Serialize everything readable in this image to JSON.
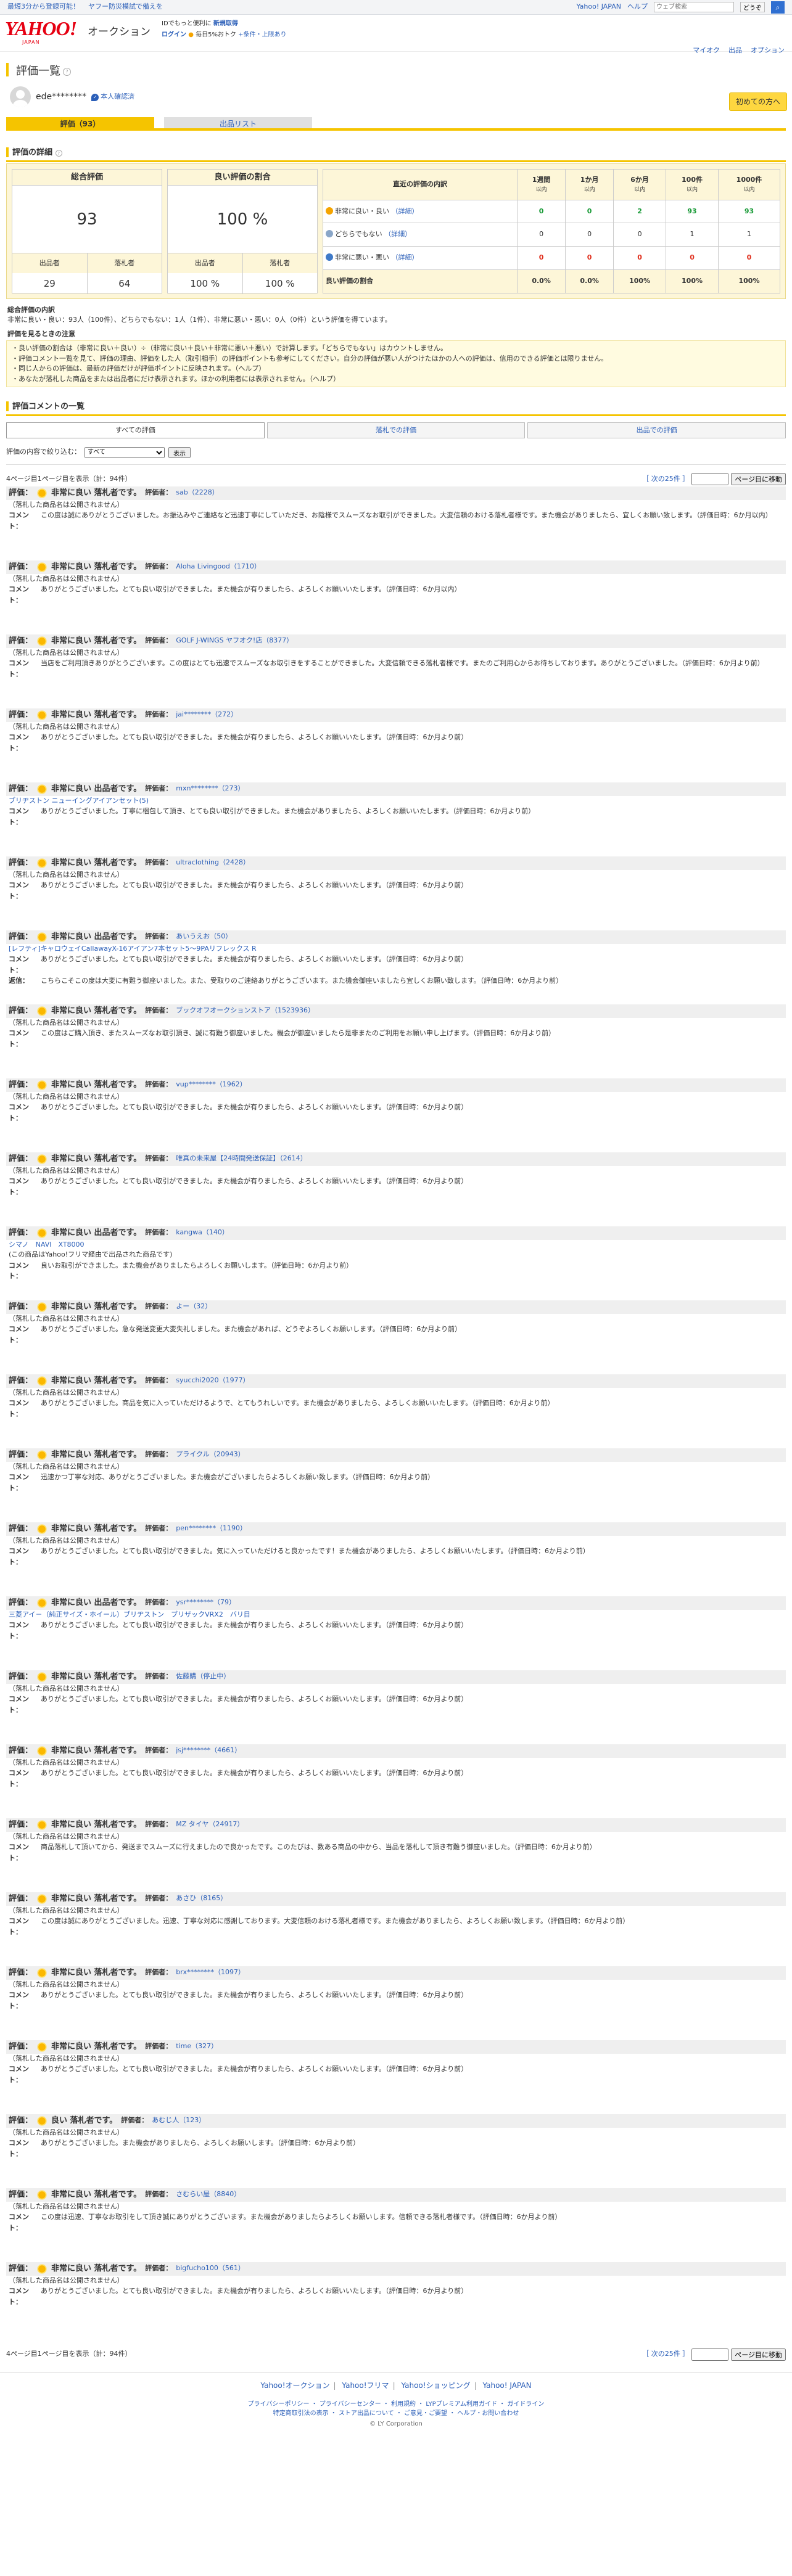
{
  "topbar": {
    "left_links": [
      "最短3分から登録可能！",
      "ヤフー防災模試で備えを"
    ],
    "right_links": [
      "Yahoo! JAPAN",
      "ヘルプ"
    ],
    "search_placeholder": "ウェブ検索",
    "search_button": "どうぞ"
  },
  "header": {
    "logo": "YAHOO!",
    "logo_sub": "JAPAN",
    "service": "オークション",
    "promo_line": "IDでもっと便利に",
    "promo_link": "新規取得",
    "login": "ログイン",
    "deal": "毎日5%おトク",
    "conditions": "+条件・上限あり",
    "links": [
      "マイオク",
      "出品",
      "オプション"
    ]
  },
  "page": {
    "title": "評価一覧",
    "guide_button": "初めての方へ",
    "user_name": "ede********",
    "verified": "本人確認済",
    "tabs": [
      "評価（93）",
      "出品リスト"
    ]
  },
  "details": {
    "section_title": "評価の詳細",
    "total_label": "総合評価",
    "total_value": "93",
    "total_sub_labels": [
      "出品者",
      "落札者"
    ],
    "total_sub_values": [
      "29",
      "64"
    ],
    "good_label": "良い評価の割合",
    "good_value": "100 %",
    "good_sub_labels": [
      "出品者",
      "落札者"
    ],
    "good_sub_values": [
      "100 %",
      "100 %"
    ],
    "recent_header": "直近の評価の内訳",
    "periods": [
      {
        "label": "1週間",
        "sub": "以内"
      },
      {
        "label": "1か月",
        "sub": "以内"
      },
      {
        "label": "6か月",
        "sub": "以内"
      },
      {
        "label": "100件",
        "sub": "以内"
      },
      {
        "label": "1000件",
        "sub": "以内"
      }
    ],
    "rows": [
      {
        "label": "非常に良い・良い",
        "detail": "（詳細）",
        "values": [
          "0",
          "0",
          "2",
          "93",
          "93"
        ]
      },
      {
        "label": "どちらでもない",
        "detail": "（詳細）",
        "values": [
          "0",
          "0",
          "0",
          "1",
          "1"
        ]
      },
      {
        "label": "非常に悪い・悪い",
        "detail": "（詳細）",
        "values": [
          "0",
          "0",
          "0",
          "0",
          "0"
        ]
      }
    ],
    "good_ratio_label": "良い評価の割合",
    "good_ratio_values": [
      "0.0%",
      "0.0%",
      "100%",
      "100%",
      "100%"
    ]
  },
  "notes": {
    "breakdown_title": "総合評価の内訳",
    "breakdown_text": "非常に良い・良い：93人（100件）、どちらでもない：1人（1件）、非常に悪い・悪い：0人（0件）という評価を得ています。",
    "caution_title": "評価を見るときの注意",
    "cautions": [
      "・良い評価の割合は（非常に良い＋良い）÷（非常に良い＋良い＋非常に悪い＋悪い）で計算します。「どちらでもない」はカウントしません。",
      "・評価コメント一覧を見て、評価の理由、評価をした人（取引相手）の評価ポイントも参考にしてください。自分の評価が悪い人がつけたほかの人への評価は、信用のできる評価とは限りません。",
      "・同じ人からの評価は、最新の評価だけが評価ポイントに反映されます。（ヘルプ）",
      "・あなたが落札した商品をまたは出品者にだけ表示されます。ほかの利用者には表示されません。（ヘルプ）"
    ]
  },
  "list": {
    "section_title": "評価コメントの一覧",
    "buttons": [
      "すべての評価",
      "落札での評価",
      "出品での評価"
    ],
    "filter_label": "評価の内容で絞り込む：",
    "filter_value": "すべて",
    "filter_button": "表示",
    "pager_text": "4ページ目1ページ目を表示（計：94件）",
    "next": "［ 次の25件 ］",
    "jump_button": "ページ目に移動"
  },
  "labels": {
    "rating": "評価：",
    "rater": "評価者：",
    "comment": "コメント：",
    "reply": "返信："
  },
  "reviews": [
    {
      "grade": "非常に良い 落札者です。",
      "rater": "sab（2228）",
      "item": "（落札した商品名は公開されません）",
      "comment": "この度は誠にありがとうございました。お振込みやご連絡など迅速丁寧にしていただき、お陰様でスムーズなお取引ができました。大変信頼のおける落札者様です。また機会がありましたら、宜しくお願い致します。（評価日時：6か月以内）"
    },
    {
      "grade": "非常に良い 落札者です。",
      "rater": "Aloha Livingood（1710）",
      "item": "（落札した商品名は公開されません）",
      "comment": "ありがとうございました。とても良い取引ができました。また機会が有りましたら、よろしくお願いいたします。（評価日時：6か月以内）"
    },
    {
      "grade": "非常に良い 落札者です。",
      "rater": "GOLF J-WINGS ヤフオク!店（8377）",
      "item": "（落札した商品名は公開されません）",
      "comment": "当店をご利用頂きありがとうございます。この度はとても迅速でスムーズなお取引きをすることができました。大変信頼できる落札者様です。またのご利用心からお待ちしております。ありがとうございました。（評価日時：6か月より前）"
    },
    {
      "grade": "非常に良い 落札者です。",
      "rater": "jai********（272）",
      "item": "（落札した商品名は公開されません）",
      "comment": "ありがとうございました。とても良い取引ができました。また機会が有りましたら、よろしくお願いいたします。（評価日時：6か月より前）"
    },
    {
      "grade": "非常に良い 出品者です。",
      "rater": "mxn********（273）",
      "item": "ブリヂストン ニューイングアイアンセット(5)",
      "comment": "ありがとうございました。丁寧に梱包して頂き、とても良い取引ができました。また機会がありましたら、よろしくお願いいたします。（評価日時：6か月より前）"
    },
    {
      "grade": "非常に良い 落札者です。",
      "rater": "ultraclothing（2428）",
      "item": "（落札した商品名は公開されません）",
      "comment": "ありがとうございました。とても良い取引ができました。また機会が有りましたら、よろしくお願いいたします。（評価日時：6か月より前）"
    },
    {
      "grade": "非常に良い 出品者です。",
      "rater": "あいうえお（50）",
      "item": "[レフティ]キャロウェイCallawayX-16アイアン7本セット5〜9PAリフレックス R",
      "comment": "ありがとうございました。とても良い取引ができました。また機会が有りましたら、よろしくお願いいたします。（評価日時：6か月より前）",
      "reply": "こちらこそこの度は大変に有難う御座いました。また、受取りのご連絡ありがとうございます。また機会御座いましたら宜しくお願い致します。（評価日時：6か月より前）"
    },
    {
      "grade": "非常に良い 落札者です。",
      "rater": "ブックオフオークションストア（1523936）",
      "item": "（落札した商品名は公開されません）",
      "comment": "この度はご購入頂き、またスムーズなお取引頂き、誠に有難う御座いました。機会が御座いましたら是非またのご利用をお願い申し上げます。（評価日時：6か月より前）"
    },
    {
      "grade": "非常に良い 落札者です。",
      "rater": "vup********（1962）",
      "item": "（落札した商品名は公開されません）",
      "comment": "ありがとうございました。とても良い取引ができました。また機会が有りましたら、よろしくお願いいたします。（評価日時：6か月より前）"
    },
    {
      "grade": "非常に良い 落札者です。",
      "rater": "唯真の未来屋【24時間発送保証】（2614）",
      "item": "（落札した商品名は公開されません）",
      "comment": "ありがとうございました。とても良い取引ができました。また機会が有りましたら、よろしくお願いいたします。（評価日時：6か月より前）"
    },
    {
      "grade": "非常に良い 出品者です。",
      "rater": "kangwa（140）",
      "item": "シマノ　NAVI　XT8000",
      "item2": "(この商品はYahoo!フリマ経由で出品された商品です)",
      "comment": "良いお取引ができました。また機会がありましたらよろしくお願いします。（評価日時：6か月より前）"
    },
    {
      "grade": "非常に良い 落札者です。",
      "rater": "よー（32）",
      "item": "（落札した商品名は公開されません）",
      "comment": "ありがとうございました。急な発送変更大変失礼しました。また機会があれば、どうぞよろしくお願いします。（評価日時：6か月より前）"
    },
    {
      "grade": "非常に良い 落札者です。",
      "rater": "syucchi2020（1977）",
      "item": "（落札した商品名は公開されません）",
      "comment": "ありがとうございました。商品を気に入っていただけるようで、とてもうれしいです。また機会がありましたら、よろしくお願いいたします。（評価日時：6か月より前）"
    },
    {
      "grade": "非常に良い 落札者です。",
      "rater": "プライクル（20943）",
      "item": "（落札した商品名は公開されません）",
      "comment": "迅速かつ丁寧な対応、ありがとうございました。また機会がございましたらよろしくお願い致します。（評価日時：6か月より前）"
    },
    {
      "grade": "非常に良い 落札者です。",
      "rater": "pen********（1190）",
      "item": "（落札した商品名は公開されません）",
      "comment": "ありがとうございました。とても良い取引ができました。気に入っていただけると良かったです！また機会がありましたら、よろしくお願いいたします。（評価日時：6か月より前）"
    },
    {
      "grade": "非常に良い 出品者です。",
      "rater": "ysr********（79）",
      "item": "三菱アイ－（純正サイズ・ホイール）ブリヂストン　ブリザックVRX2　バリ目",
      "comment": "ありがとうございました。とても良い取引ができました。また機会が有りましたら、よろしくお願いいたします。（評価日時：6か月より前）"
    },
    {
      "grade": "非常に良い 落札者です。",
      "rater": "佐藤購（停止中）",
      "item": "（落札した商品名は公開されません）",
      "comment": "ありがとうございました。とても良い取引ができました。また機会が有りましたら、よろしくお願いいたします。（評価日時：6か月より前）"
    },
    {
      "grade": "非常に良い 落札者です。",
      "rater": "jsj********（4661）",
      "item": "（落札した商品名は公開されません）",
      "comment": "ありがとうございました。とても良い取引ができました。また機会が有りましたら、よろしくお願いいたします。（評価日時：6か月より前）"
    },
    {
      "grade": "非常に良い 落札者です。",
      "rater": "MZ タイヤ（24917）",
      "item": "（落札した商品名は公開されません）",
      "comment": "商品落札して頂いてから、発送までスムーズに行えましたので良かったです。このたびは、数ある商品の中から、当品を落札して頂き有難う御座いました。（評価日時：6か月より前）"
    },
    {
      "grade": "非常に良い 落札者です。",
      "rater": "あさひ（8165）",
      "item": "（落札した商品名は公開されません）",
      "comment": "この度は誠にありがとうございました。迅速、丁寧な対応に感謝しております。大変信頼のおける落札者様です。また機会がありましたら、よろしくお願い致します。（評価日時：6か月より前）"
    },
    {
      "grade": "非常に良い 落札者です。",
      "rater": "brx********（1097）",
      "item": "（落札した商品名は公開されません）",
      "comment": "ありがとうございました。とても良い取引ができました。また機会が有りましたら、よろしくお願いいたします。（評価日時：6か月より前）"
    },
    {
      "grade": "非常に良い 落札者です。",
      "rater": "time（327）",
      "item": "（落札した商品名は公開されません）",
      "comment": "ありがとうございました。とても良い取引ができました。また機会が有りましたら、よろしくお願いいたします。（評価日時：6か月より前）"
    },
    {
      "grade": "良い 落札者です。",
      "rater": "あむじ人（123）",
      "item": "（落札した商品名は公開されません）",
      "comment": "ありがとうございました。また機会がありましたら、よろしくお願いします。（評価日時：6か月より前）"
    },
    {
      "grade": "非常に良い 落札者です。",
      "rater": "さむらい屋（8840）",
      "item": "（落札した商品名は公開されません）",
      "comment": "この度は迅速、丁寧なお取引をして頂き誠にありがとうございます。また機会がありましたらよろしくお願いします。信頼できる落札者様です。（評価日時：6か月より前）"
    },
    {
      "grade": "非常に良い 落札者です。",
      "rater": "bigfucho100（561）",
      "item": "（落札した商品名は公開されません）",
      "comment": "ありがとうございました。とても良い取引ができました。また機会が有りましたら、よろしくお願いいたします。（評価日時：6か月より前）"
    }
  ],
  "footer": {
    "links": [
      "Yahoo!オークション",
      "Yahoo!フリマ",
      "Yahoo!ショッピング",
      "Yahoo! JAPAN"
    ],
    "line2": "プライバシーポリシー ・ プライバシーセンター ・ 利用規約 ・ LYPプレミアム利用ガイド ・ ガイドライン",
    "line3": "特定商取引法の表示 ・ ストア出品について ・ ご意見・ご要望 ・ ヘルプ・お問い合わせ",
    "copyright": "© LY Corporation"
  },
  "colors": {
    "accent": "#f5c400",
    "link": "#2a5eb8",
    "good": "#1a9b38",
    "bad": "#e0301e"
  }
}
